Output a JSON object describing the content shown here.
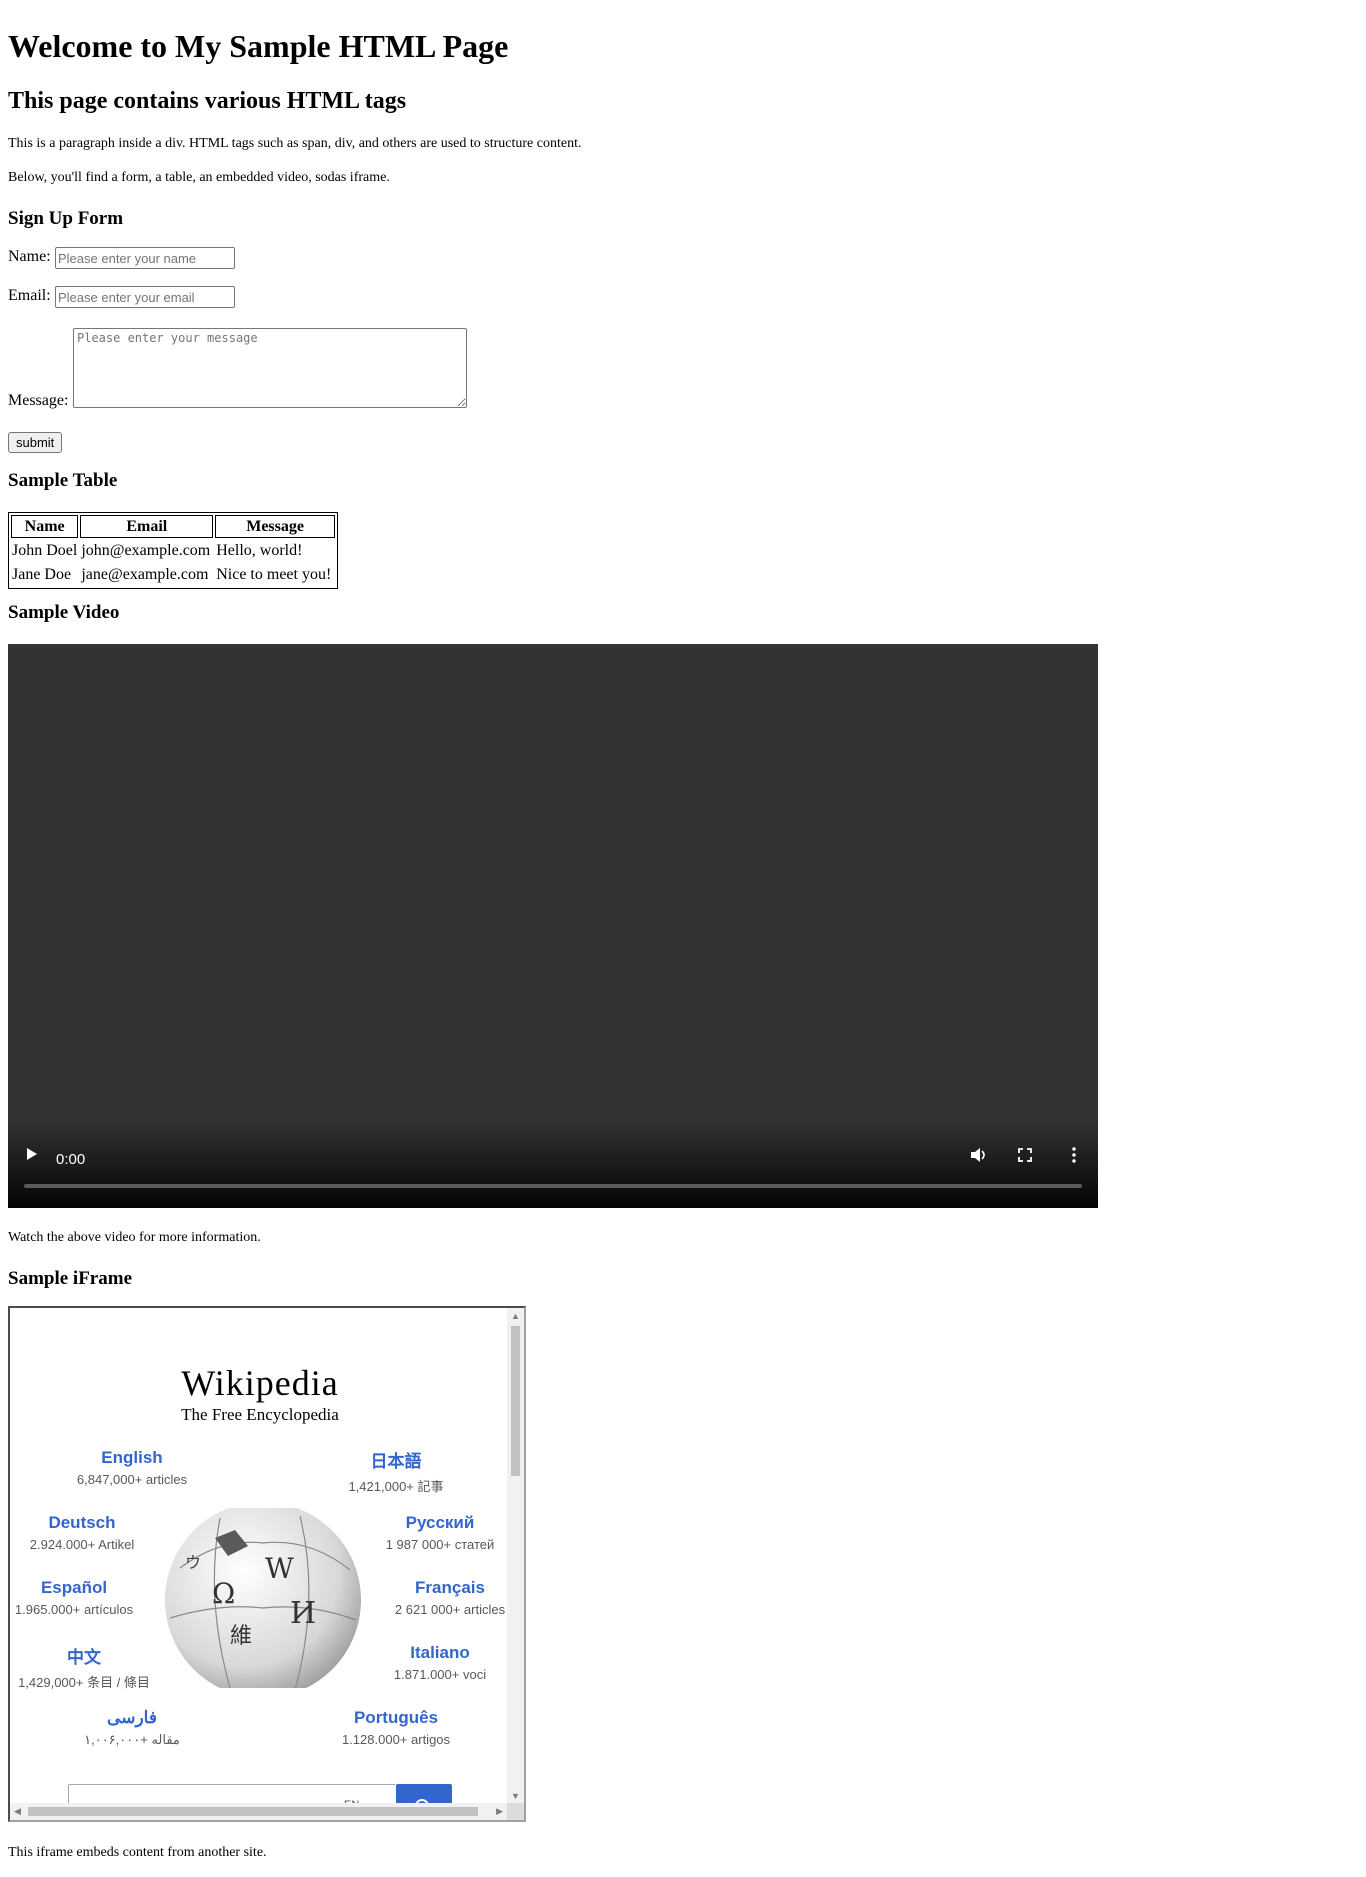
{
  "page": {
    "title": "Welcome to My Sample HTML Page",
    "subtitle": "This page contains various HTML tags",
    "para1": "This is a paragraph inside a div. HTML tags such as span, div, and others are used to structure content.",
    "para2": "Below, you'll find a form, a table, an embedded video, sodas iframe."
  },
  "form": {
    "heading": "Sign Up Form",
    "name_label": "Name:",
    "name_placeholder": "Please enter your name",
    "email_label": "Email:",
    "email_placeholder": "Please enter your email",
    "message_label": "Message:",
    "message_placeholder": "Please enter your message",
    "submit_label": "submit"
  },
  "table": {
    "heading": "Sample Table",
    "columns": [
      "Name",
      "Email",
      "Message"
    ],
    "rows": [
      [
        "John Doel",
        "john@example.com",
        "Hello, world!"
      ],
      [
        "Jane Doe",
        "jane@example.com",
        "Nice to meet you!"
      ]
    ]
  },
  "video": {
    "heading": "Sample Video",
    "time": "0:00",
    "caption": "Watch the above video for more information."
  },
  "iframe": {
    "heading": "Sample iFrame",
    "caption": "This iframe embeds content from another site.",
    "wiki_title": "Wikipedia",
    "wiki_subtitle": "The Free Encyclopedia",
    "languages": [
      {
        "name": "English",
        "count": "6,847,000+ articles"
      },
      {
        "name": "日本語",
        "count": "1,421,000+ 記事"
      },
      {
        "name": "Deutsch",
        "count": "2.924.000+ Artikel"
      },
      {
        "name": "Русский",
        "count": "1 987 000+ статей"
      },
      {
        "name": "Español",
        "count": "1.965.000+ artículos"
      },
      {
        "name": "Français",
        "count": "2 621 000+ articles"
      },
      {
        "name": "中文",
        "count": "1,429,000+ 条目 / 條目"
      },
      {
        "name": "Italiano",
        "count": "1.871.000+ voci"
      },
      {
        "name": "فارسی",
        "count": "۱,۰۰۶,۰۰۰+ مقاله"
      },
      {
        "name": "Português",
        "count": "1.128.000+ artigos"
      }
    ],
    "search_lang": "EN"
  },
  "colors": {
    "link": "#3366cc",
    "video_bg": "#333333"
  }
}
